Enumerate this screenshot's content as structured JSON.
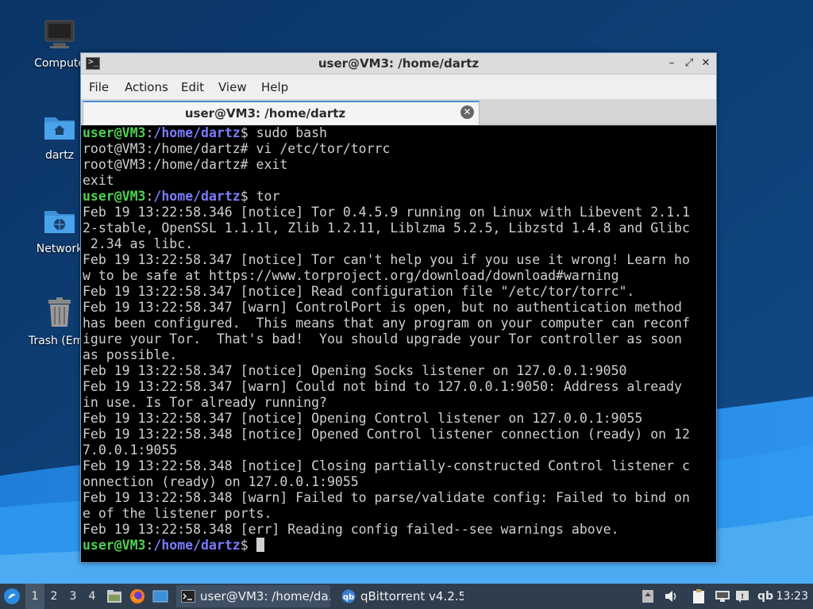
{
  "desktop": {
    "icons": [
      {
        "label": "Compute",
        "icon": "computer-icon"
      },
      {
        "label": "dartz",
        "icon": "home-folder-icon"
      },
      {
        "label": "Network",
        "icon": "network-folder-icon"
      },
      {
        "label": "Trash (Emp",
        "icon": "trash-icon"
      }
    ]
  },
  "window": {
    "title": "user@VM3: /home/dartz",
    "controls": {
      "minimize": "–",
      "maximize": "⤢",
      "close": "✕"
    },
    "menu": [
      "File",
      "Actions",
      "Edit",
      "View",
      "Help"
    ],
    "tab": {
      "label": "user@VM3: /home/dartz",
      "close": "✕"
    }
  },
  "terminal": {
    "prompt_user": "user@VM3",
    "prompt_path": "/home/dartz",
    "lines": [
      {
        "type": "prompt",
        "cmd": " sudo bash"
      },
      {
        "type": "text",
        "text": "root@VM3:/home/dartz# vi /etc/tor/torrc"
      },
      {
        "type": "text",
        "text": "root@VM3:/home/dartz# exit"
      },
      {
        "type": "text",
        "text": "exit"
      },
      {
        "type": "prompt",
        "cmd": " tor"
      },
      {
        "type": "text",
        "text": "Feb 19 13:22:58.346 [notice] Tor 0.4.5.9 running on Linux with Libevent 2.1.1"
      },
      {
        "type": "text",
        "text": "2-stable, OpenSSL 1.1.1l, Zlib 1.2.11, Liblzma 5.2.5, Libzstd 1.4.8 and Glibc"
      },
      {
        "type": "text",
        "text": " 2.34 as libc."
      },
      {
        "type": "text",
        "text": "Feb 19 13:22:58.347 [notice] Tor can't help you if you use it wrong! Learn ho"
      },
      {
        "type": "text",
        "text": "w to be safe at https://www.torproject.org/download/download#warning"
      },
      {
        "type": "text",
        "text": "Feb 19 13:22:58.347 [notice] Read configuration file \"/etc/tor/torrc\"."
      },
      {
        "type": "text",
        "text": "Feb 19 13:22:58.347 [warn] ControlPort is open, but no authentication method"
      },
      {
        "type": "text",
        "text": "has been configured.  This means that any program on your computer can reconf"
      },
      {
        "type": "text",
        "text": "igure your Tor.  That's bad!  You should upgrade your Tor controller as soon"
      },
      {
        "type": "text",
        "text": "as possible."
      },
      {
        "type": "text",
        "text": "Feb 19 13:22:58.347 [notice] Opening Socks listener on 127.0.0.1:9050"
      },
      {
        "type": "text",
        "text": "Feb 19 13:22:58.347 [warn] Could not bind to 127.0.0.1:9050: Address already"
      },
      {
        "type": "text",
        "text": "in use. Is Tor already running?"
      },
      {
        "type": "text",
        "text": "Feb 19 13:22:58.347 [notice] Opening Control listener on 127.0.0.1:9055"
      },
      {
        "type": "text",
        "text": "Feb 19 13:22:58.348 [notice] Opened Control listener connection (ready) on 12"
      },
      {
        "type": "text",
        "text": "7.0.0.1:9055"
      },
      {
        "type": "text",
        "text": "Feb 19 13:22:58.348 [notice] Closing partially-constructed Control listener c"
      },
      {
        "type": "text",
        "text": "onnection (ready) on 127.0.0.1:9055"
      },
      {
        "type": "text",
        "text": "Feb 19 13:22:58.348 [warn] Failed to parse/validate config: Failed to bind on"
      },
      {
        "type": "text",
        "text": "e of the listener ports."
      },
      {
        "type": "text",
        "text": "Feb 19 13:22:58.348 [err] Reading config failed--see warnings above."
      },
      {
        "type": "prompt",
        "cmd": " ",
        "cursor": true
      }
    ]
  },
  "taskbar": {
    "workspaces": [
      "1",
      "2",
      "3",
      "4"
    ],
    "tasks": [
      {
        "label": "user@VM3: /home/da...",
        "icon": "terminal-icon"
      },
      {
        "label": "qBittorrent v4.2.5",
        "icon": "qbittorrent-icon"
      }
    ],
    "tray_qb": "qb",
    "clock": "13:23"
  },
  "colors": {
    "prompt_user": "#4fd14f",
    "prompt_path": "#7b7bff",
    "terminal_bg": "#000000",
    "taskbar_bg": "#2e3e4f"
  }
}
